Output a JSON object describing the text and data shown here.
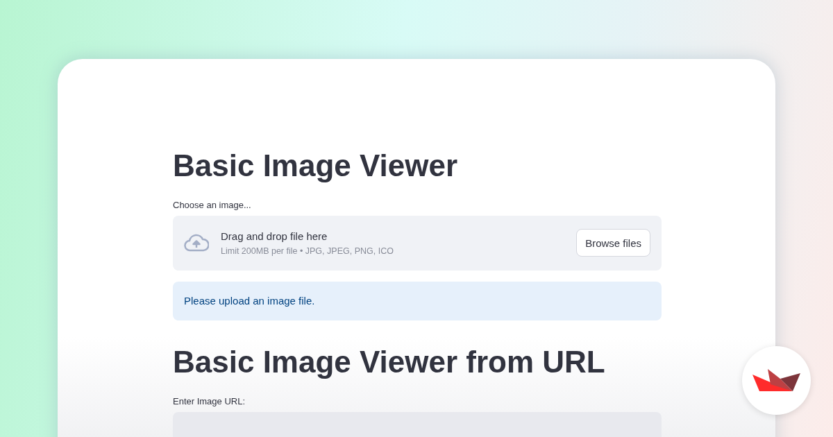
{
  "sections": [
    {
      "kind": "upload",
      "title": "Basic Image Viewer",
      "label": "Choose an image...",
      "uploader": {
        "headline": "Drag and drop file here",
        "limit": "Limit 200MB per file • JPG, JPEG, PNG, ICO",
        "button": "Browse files"
      },
      "alert": "Please upload an image file."
    },
    {
      "kind": "url",
      "title": "Basic Image Viewer from URL",
      "label": "Enter Image URL:"
    }
  ]
}
